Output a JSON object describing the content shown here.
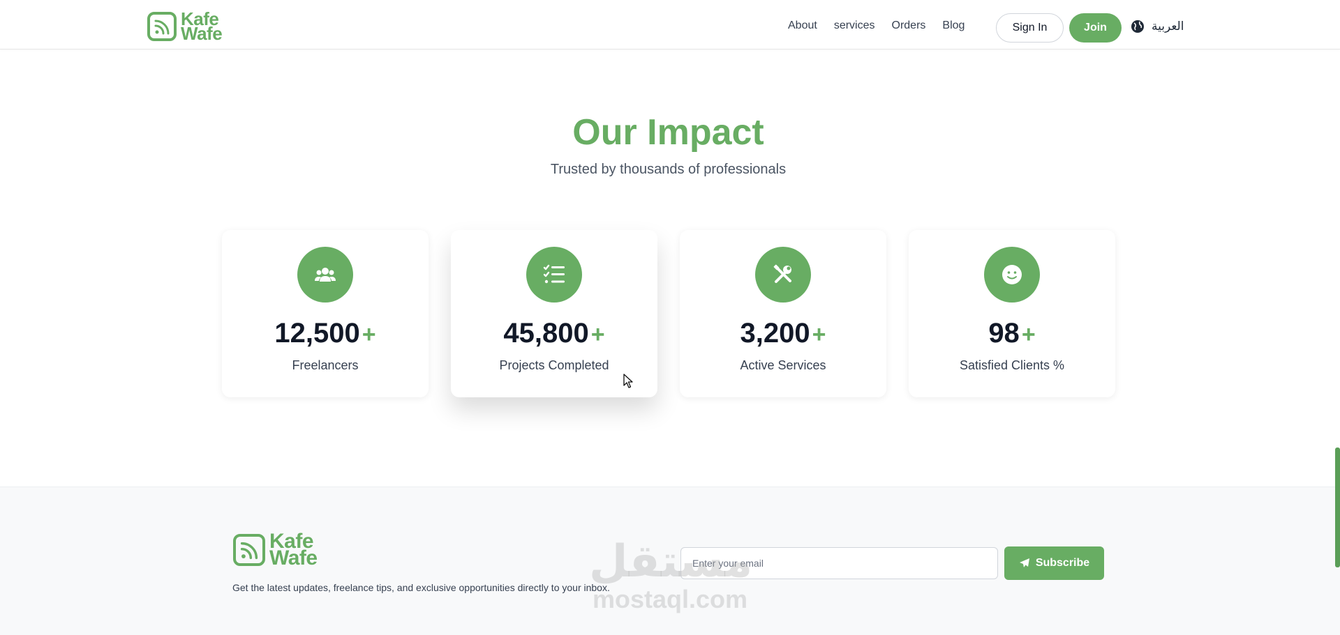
{
  "header": {
    "logo": {
      "line1": "Kafe",
      "line2": "Wafe"
    },
    "nav": [
      "About",
      "services",
      "Orders",
      "Blog"
    ],
    "sign_in": "Sign In",
    "join": "Join",
    "language": "العربية",
    "language_icon": "globe-icon"
  },
  "impact": {
    "title": "Our Impact",
    "subtitle": "Trusted by thousands of professionals",
    "stats": [
      {
        "icon": "users-icon",
        "value": "12,500",
        "suffix": "+",
        "label": "Freelancers"
      },
      {
        "icon": "list-check-icon",
        "value": "45,800",
        "suffix": "+",
        "label": "Projects Completed"
      },
      {
        "icon": "tools-icon",
        "value": "3,200",
        "suffix": "+",
        "label": "Active Services"
      },
      {
        "icon": "smile-icon",
        "value": "98",
        "suffix": "+",
        "label": "Satisfied Clients %"
      }
    ]
  },
  "footer": {
    "logo": {
      "line1": "Kafe",
      "line2": "Wafe"
    },
    "tagline": "Get the latest updates, freelance tips, and exclusive opportunities directly to your inbox.",
    "email_placeholder": "Enter your email",
    "subscribe": "Subscribe",
    "subscribe_icon": "paper-plane-icon"
  },
  "watermark": {
    "arabic": "مستقل",
    "latin": "mostaql.com"
  },
  "colors": {
    "brand": "#68ad63",
    "text": "#1f2937",
    "footer_bg": "#f8f9fa"
  }
}
